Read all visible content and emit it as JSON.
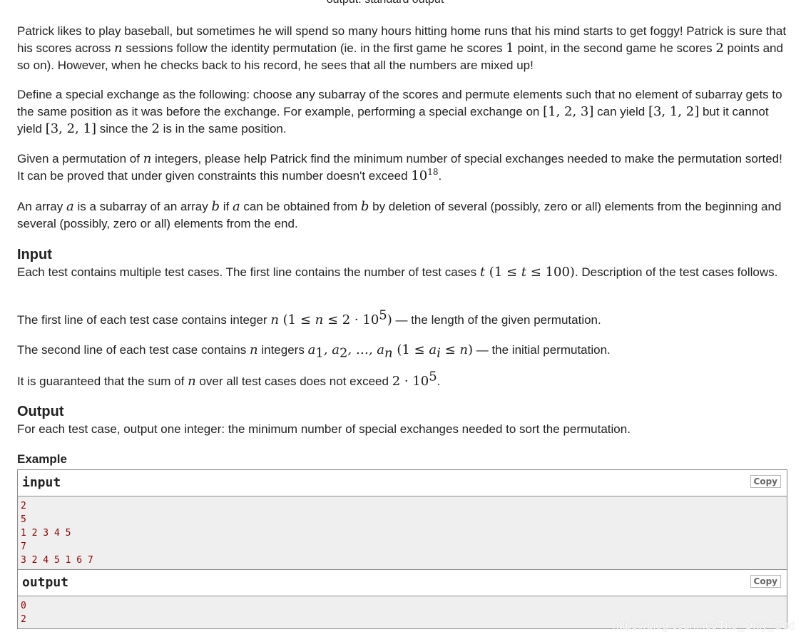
{
  "header": {
    "output_spec": "output: standard output"
  },
  "statement": {
    "p1": {
      "t1": "Patrick likes to play baseball, but sometimes he will spend so many hours hitting home runs that his mind starts to get foggy! Patrick is sure that his scores across ",
      "m1": "n",
      "t2": " sessions follow the identity permutation (ie. in the first game he scores ",
      "m2": "1",
      "t3": " point, in the second game he scores ",
      "m3": "2",
      "t4": " points and so on). However, when he checks back to his record, he sees that all the numbers are mixed up!"
    },
    "p2": {
      "t1": "Define a special exchange as the following: choose any subarray of the scores and permute elements such that no element of subarray gets to the same position as it was before the exchange. For example, performing a special exchange on ",
      "m1": "[1, 2, 3]",
      "t2": " can yield ",
      "m2": "[3, 1, 2]",
      "t3": " but it cannot yield ",
      "m3": "[3, 2, 1]",
      "t4": " since the ",
      "m4": "2",
      "t5": " is in the same position."
    },
    "p3": {
      "t1": "Given a permutation of ",
      "m1": "n",
      "t2": " integers, please help Patrick find the minimum number of special exchanges needed to make the permutation sorted! It can be proved that under given constraints this number doesn't exceed ",
      "m2_base": "10",
      "m2_exp": "18",
      "t3": "."
    },
    "p4": {
      "t1": "An array ",
      "m1": "a",
      "t2": " is a subarray of an array ",
      "m2": "b",
      "t3": " if ",
      "m3": "a",
      "t4": " can be obtained from ",
      "m4": "b",
      "t5": " by deletion of several (possibly, zero or all) elements from the beginning and several (possibly, zero or all) elements from the end."
    }
  },
  "input_section": {
    "title": "Input",
    "p1": {
      "t1": "Each test contains multiple test cases. The first line contains the number of test cases ",
      "m1": "t",
      "m2": " (1 ≤ ",
      "m3": "t",
      "m4": " ≤ 100)",
      "t2": ". Description of the test cases follows."
    },
    "p2": {
      "t1": "The first line of each test case contains integer ",
      "m1": "n",
      "m2": " (1 ≤ ",
      "m3": "n",
      "m4": " ≤ 2 · 10",
      "m4_exp": "5",
      "m5": ")",
      "t2": " — the length of the given permutation."
    },
    "p3": {
      "t1": "The second line of each test case contains ",
      "m1": "n",
      "t2": " integers ",
      "m2": "a",
      "m2_sub": "1",
      "m3": ", a",
      "m3_sub": "2",
      "m4": ", …, a",
      "m4_sub": "n",
      "m5": " (1 ≤ ",
      "m6": "a",
      "m6_sub": "i",
      "m7": " ≤ ",
      "m8": "n",
      "m9": ")",
      "t3": " — the initial permutation."
    },
    "p4": {
      "t1": "It is guaranteed that the sum of ",
      "m1": "n",
      "t2": " over all test cases does not exceed ",
      "m2": "2 · 10",
      "m2_exp": "5",
      "t3": "."
    }
  },
  "output_section": {
    "title": "Output",
    "p1": "For each test case, output one integer: the minimum number of special exchanges needed to sort the permutation."
  },
  "example": {
    "title": "Example",
    "input": {
      "label": "input",
      "copy_label": "Copy",
      "lines": [
        "2",
        "5",
        "1 2 3 4 5",
        "7",
        "3 2 4 5 1 6 7"
      ]
    },
    "output": {
      "label": "output",
      "copy_label": "Copy",
      "lines": [
        "0",
        "2"
      ]
    }
  },
  "watermark": "https://blog.csdn.net/The_Only_God"
}
